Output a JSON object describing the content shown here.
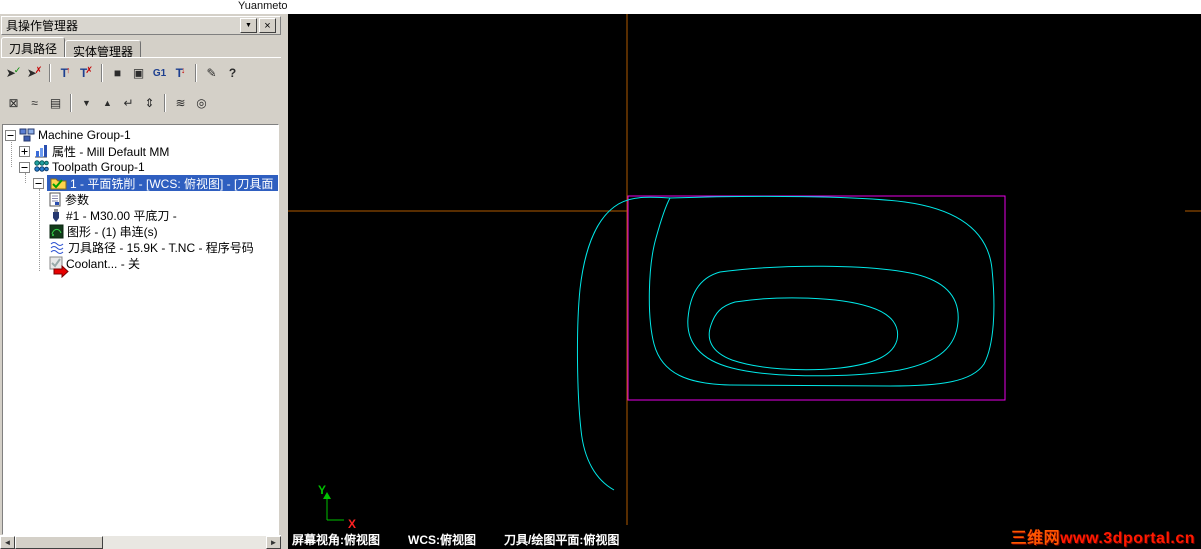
{
  "page": {
    "top_text": "Yuanmeto"
  },
  "panel": {
    "title": "具操作管理器",
    "window_buttons": {
      "dropdown": "▼",
      "close": "×"
    },
    "tabs": [
      {
        "label": "刀具路径"
      },
      {
        "label": "实体管理器"
      }
    ],
    "toolbar_row1": [
      {
        "name": "select-all-operations",
        "glyph": "➤",
        "mark": "✓"
      },
      {
        "name": "deselect-all-operations",
        "glyph": "➤",
        "mark": "✗"
      },
      {
        "name": "regen-selected-operations",
        "glyph": "T",
        "mark": "↑"
      },
      {
        "name": "regen-all-dirty-operations",
        "glyph": "T",
        "mark": "✗"
      },
      {
        "name": "verify",
        "glyph": "■",
        "mark": ""
      },
      {
        "name": "backplot",
        "glyph": "▣",
        "mark": ""
      },
      {
        "name": "post-g1",
        "glyph": "G1",
        "mark": ""
      },
      {
        "name": "edit-selected-operations",
        "glyph": "T",
        "mark": "↓"
      },
      {
        "name": "delete-operations",
        "glyph": "✎",
        "mark": ""
      },
      {
        "name": "help",
        "glyph": "?",
        "mark": ""
      }
    ],
    "toolbar_row2": [
      {
        "name": "lock-toolpath",
        "glyph": "⊠"
      },
      {
        "name": "toggle-toolpath-display",
        "glyph": "≈"
      },
      {
        "name": "lock-posting",
        "glyph": "▤"
      },
      {
        "name": "move-insert-down",
        "glyph": "▼"
      },
      {
        "name": "move-insert-up",
        "glyph": "▲"
      },
      {
        "name": "move-insert-to-end",
        "glyph": "↵"
      },
      {
        "name": "scroll-insert",
        "glyph": "⇕"
      },
      {
        "name": "display-options",
        "glyph": "≋"
      },
      {
        "name": "single-display",
        "glyph": "◎"
      }
    ],
    "scrollbar": {
      "left": "◄",
      "right": "►"
    }
  },
  "tree": {
    "items": [
      {
        "label": "Machine Group-1",
        "icon": "machine-group"
      },
      {
        "label": "属性 - Mill Default MM",
        "icon": "properties"
      },
      {
        "label": "Toolpath Group-1",
        "icon": "toolpath-group"
      },
      {
        "label": "1 - 平面铣削 - [WCS: 俯视图] - [刀具面",
        "icon": "operation-folder",
        "selected": true
      },
      {
        "label": "参数",
        "icon": "parameters"
      },
      {
        "label": "#1 - M30.00 平底刀 -",
        "icon": "tool"
      },
      {
        "label": "图形 - (1) 串连(s)",
        "icon": "geometry"
      },
      {
        "label": "刀具路径 - 15.9K - T.NC - 程序号码",
        "icon": "toolpath-file"
      },
      {
        "label": "Coolant... - 关",
        "icon": "coolant"
      }
    ]
  },
  "viewport": {
    "status": [
      "屏幕视角:俯视图",
      "WCS:俯视图",
      "刀具/绘图平面:俯视图"
    ],
    "axes": {
      "x_label": "X",
      "y_label": "Y"
    },
    "watermark": {
      "site": "三维网",
      "url": "www.3dportal.cn"
    },
    "colors": {
      "toolpath": "#00e8e8",
      "boundary": "#e800e8",
      "axis_line": "#b05a00",
      "x_axis_label": "#ff2222",
      "y_axis_label": "#00c000"
    }
  }
}
